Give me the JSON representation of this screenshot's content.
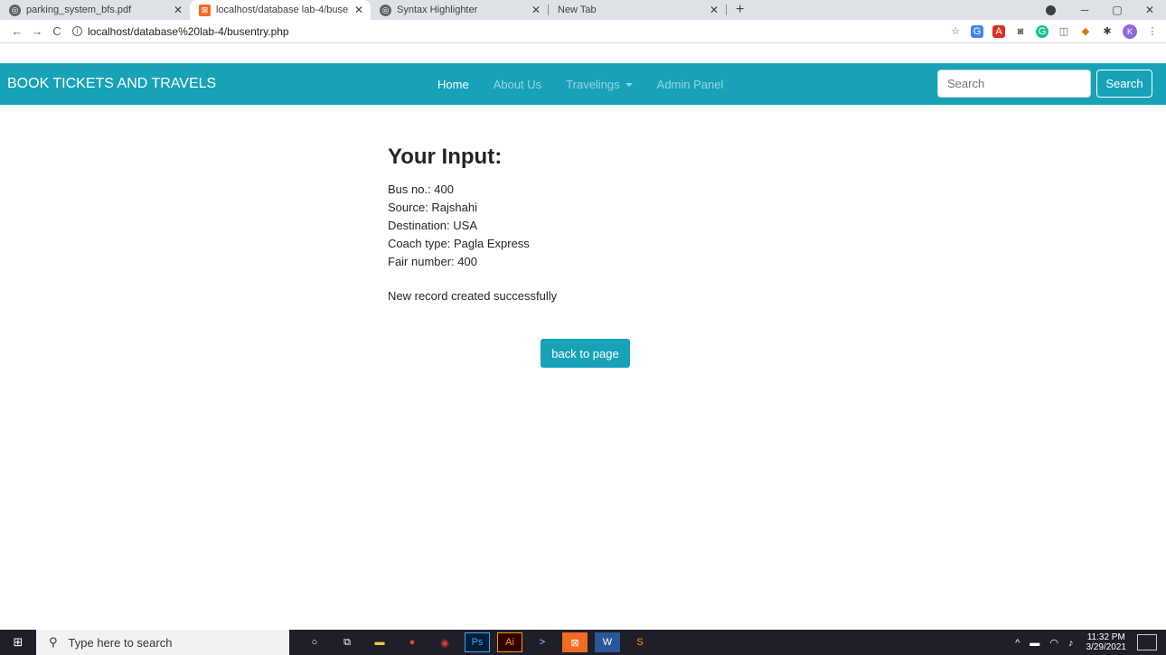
{
  "browser": {
    "tabs": [
      {
        "title": "parking_system_bfs.pdf",
        "active": false
      },
      {
        "title": "localhost/database lab-4/busentr",
        "active": true
      },
      {
        "title": "Syntax Highlighter",
        "active": false
      },
      {
        "title": "New Tab",
        "active": false
      }
    ],
    "url": "localhost/database%20lab-4/busentry.php",
    "profile_initial": "K"
  },
  "navbar": {
    "brand": "BOOK TICKETS AND TRAVELS",
    "links": [
      {
        "label": "Home",
        "active": true
      },
      {
        "label": "About Us",
        "active": false
      },
      {
        "label": "Travelings",
        "active": false,
        "dropdown": true
      },
      {
        "label": "Admin Panel",
        "active": false
      }
    ],
    "search_placeholder": "Search",
    "search_button": "Search"
  },
  "content": {
    "heading": "Your Input:",
    "lines": [
      "Bus no.: 400",
      "Source: Rajshahi",
      "Destination: USA",
      "Coach type: Pagla Express",
      "Fair number: 400"
    ],
    "message": "New record created successfully",
    "back_button": "back to page"
  },
  "taskbar": {
    "search_placeholder": "Type here to search",
    "time": "11:32 PM",
    "date": "3/29/2021"
  },
  "colors": {
    "navbar_bg": "#17a2b8",
    "tabstrip_bg": "#dee1e6",
    "taskbar_bg": "#1f1f2a"
  }
}
